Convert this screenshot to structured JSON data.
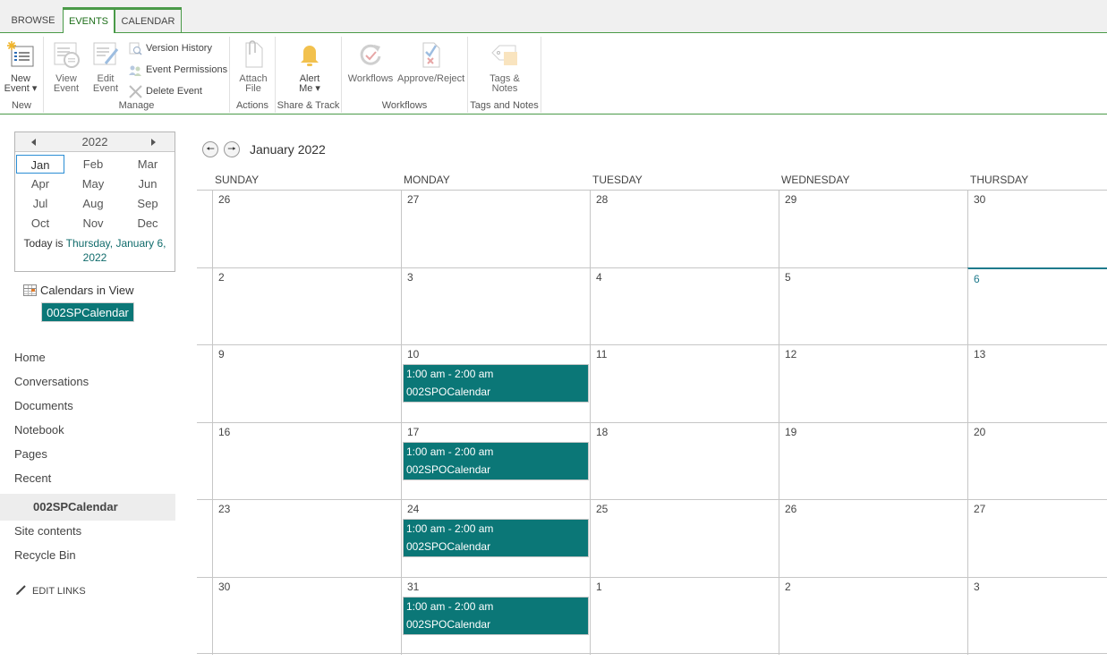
{
  "ribbon": {
    "tabs": [
      {
        "label": "BROWSE",
        "active": false
      },
      {
        "label": "EVENTS",
        "active": true
      },
      {
        "label": "CALENDAR",
        "active": false
      }
    ],
    "groups": {
      "new": {
        "label": "New",
        "new_event": {
          "line1": "New",
          "line2": "Event ▾",
          "icon": "new-event-icon"
        }
      },
      "manage": {
        "label": "Manage",
        "view_event": {
          "line1": "View",
          "line2": "Event",
          "icon": "view-event-icon"
        },
        "edit_event": {
          "line1": "Edit",
          "line2": "Event",
          "icon": "edit-event-icon"
        },
        "version_history": "Version History",
        "event_permissions": "Event Permissions",
        "delete_event": "Delete Event"
      },
      "actions": {
        "label": "Actions",
        "attach_file": {
          "line1": "Attach",
          "line2": "File",
          "icon": "paperclip-icon"
        }
      },
      "share_track": {
        "label": "Share & Track",
        "alert_me": {
          "line1": "Alert",
          "line2": "Me ▾",
          "icon": "bell-icon"
        }
      },
      "workflows": {
        "label": "Workflows",
        "workflows": "Workflows",
        "approve_reject": "Approve/Reject"
      },
      "tags_notes": {
        "label": "Tags and Notes",
        "tags": {
          "line1": "Tags &",
          "line2": "Notes",
          "icon": "tag-icon"
        }
      }
    }
  },
  "datepicker": {
    "year": "2022",
    "months": [
      "Jan",
      "Feb",
      "Mar",
      "Apr",
      "May",
      "Jun",
      "Jul",
      "Aug",
      "Sep",
      "Oct",
      "Nov",
      "Dec"
    ],
    "selected_month": "Jan",
    "today_prefix": "Today is ",
    "today_link": "Thursday, January 6,",
    "today_year": "2022"
  },
  "calendars_in_view": {
    "label": "Calendars in View",
    "calendar": "002SPCalendar"
  },
  "nav": {
    "items": [
      "Home",
      "Conversations",
      "Documents",
      "Notebook",
      "Pages",
      "Recent"
    ],
    "recent_sub": "002SPCalendar",
    "items2": [
      "Site contents",
      "Recycle Bin"
    ],
    "edit_links": "EDIT LINKS"
  },
  "calendar": {
    "title": "January 2022",
    "days_of_week": [
      "SUNDAY",
      "MONDAY",
      "TUESDAY",
      "WEDNESDAY",
      "THURSDAY"
    ],
    "today": "6",
    "accent": "#0b7777",
    "weeks": [
      {
        "days": [
          "26",
          "27",
          "28",
          "29",
          "30"
        ],
        "events": {}
      },
      {
        "days": [
          "2",
          "3",
          "4",
          "5",
          "6"
        ],
        "events": {}
      },
      {
        "days": [
          "9",
          "10",
          "11",
          "12",
          "13"
        ],
        "events": {
          "1": {
            "time": "1:00 am - 2:00 am",
            "title": "002SPOCalendar"
          }
        }
      },
      {
        "days": [
          "16",
          "17",
          "18",
          "19",
          "20"
        ],
        "events": {
          "1": {
            "time": "1:00 am - 2:00 am",
            "title": "002SPOCalendar"
          }
        }
      },
      {
        "days": [
          "23",
          "24",
          "25",
          "26",
          "27"
        ],
        "events": {
          "1": {
            "time": "1:00 am - 2:00 am",
            "title": "002SPOCalendar"
          }
        }
      },
      {
        "days": [
          "30",
          "31",
          "1",
          "2",
          "3"
        ],
        "events": {
          "1": {
            "time": "1:00 am - 2:00 am",
            "title": "002SPOCalendar"
          }
        }
      }
    ]
  }
}
